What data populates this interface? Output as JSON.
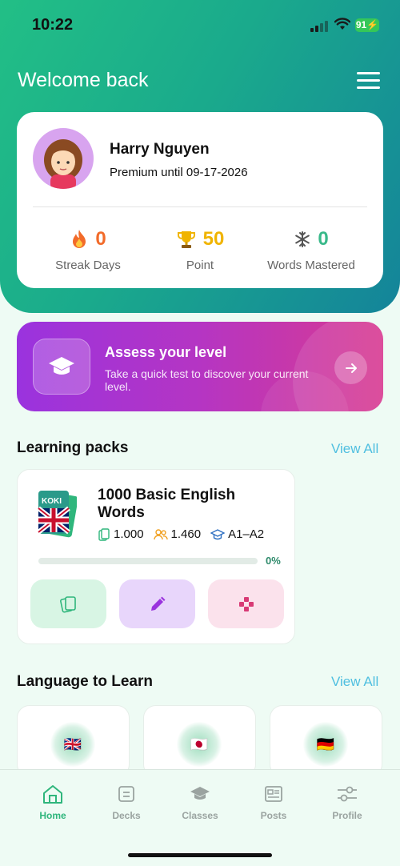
{
  "status_bar": {
    "time": "10:22",
    "battery": "91"
  },
  "header": {
    "welcome": "Welcome back"
  },
  "profile": {
    "name": "Harry Nguyen",
    "premium": "Premium until 09-17-2026",
    "stats": [
      {
        "value": "0",
        "label": "Streak Days",
        "icon": "fire-icon",
        "color": "#f26b2a"
      },
      {
        "value": "50",
        "label": "Point",
        "icon": "trophy-icon",
        "color": "#f0b400"
      },
      {
        "value": "0",
        "label": "Words Mastered",
        "icon": "snowflake-icon",
        "color": "#39b98a"
      }
    ]
  },
  "assess": {
    "title": "Assess your level",
    "subtitle": "Take a quick test to discover your current level."
  },
  "learning_packs": {
    "title": "Learning packs",
    "view_all": "View All",
    "pack": {
      "title": "1000 Basic English Words",
      "cards": "1.000",
      "learners": "1.460",
      "level": "A1–A2",
      "progress_percent": 0,
      "progress_label": "0%",
      "logo_text": "KOKI"
    }
  },
  "languages": {
    "title": "Language to Learn",
    "view_all": "View All",
    "items": [
      {
        "flag": "🇬🇧"
      },
      {
        "flag": "🇯🇵"
      },
      {
        "flag": "🇩🇪"
      }
    ]
  },
  "tabs": [
    {
      "label": "Home",
      "icon": "home-icon",
      "active": true
    },
    {
      "label": "Decks",
      "icon": "decks-icon",
      "active": false
    },
    {
      "label": "Classes",
      "icon": "graduation-cap-icon",
      "active": false
    },
    {
      "label": "Posts",
      "icon": "newspaper-icon",
      "active": false
    },
    {
      "label": "Profile",
      "icon": "sliders-icon",
      "active": false
    }
  ],
  "colors": {
    "accent": "#2fb67c",
    "link": "#4fbfe0",
    "hero_start": "#22bf86",
    "hero_end": "#14849a",
    "assess_start": "#9a33de",
    "assess_end": "#d83a91"
  }
}
